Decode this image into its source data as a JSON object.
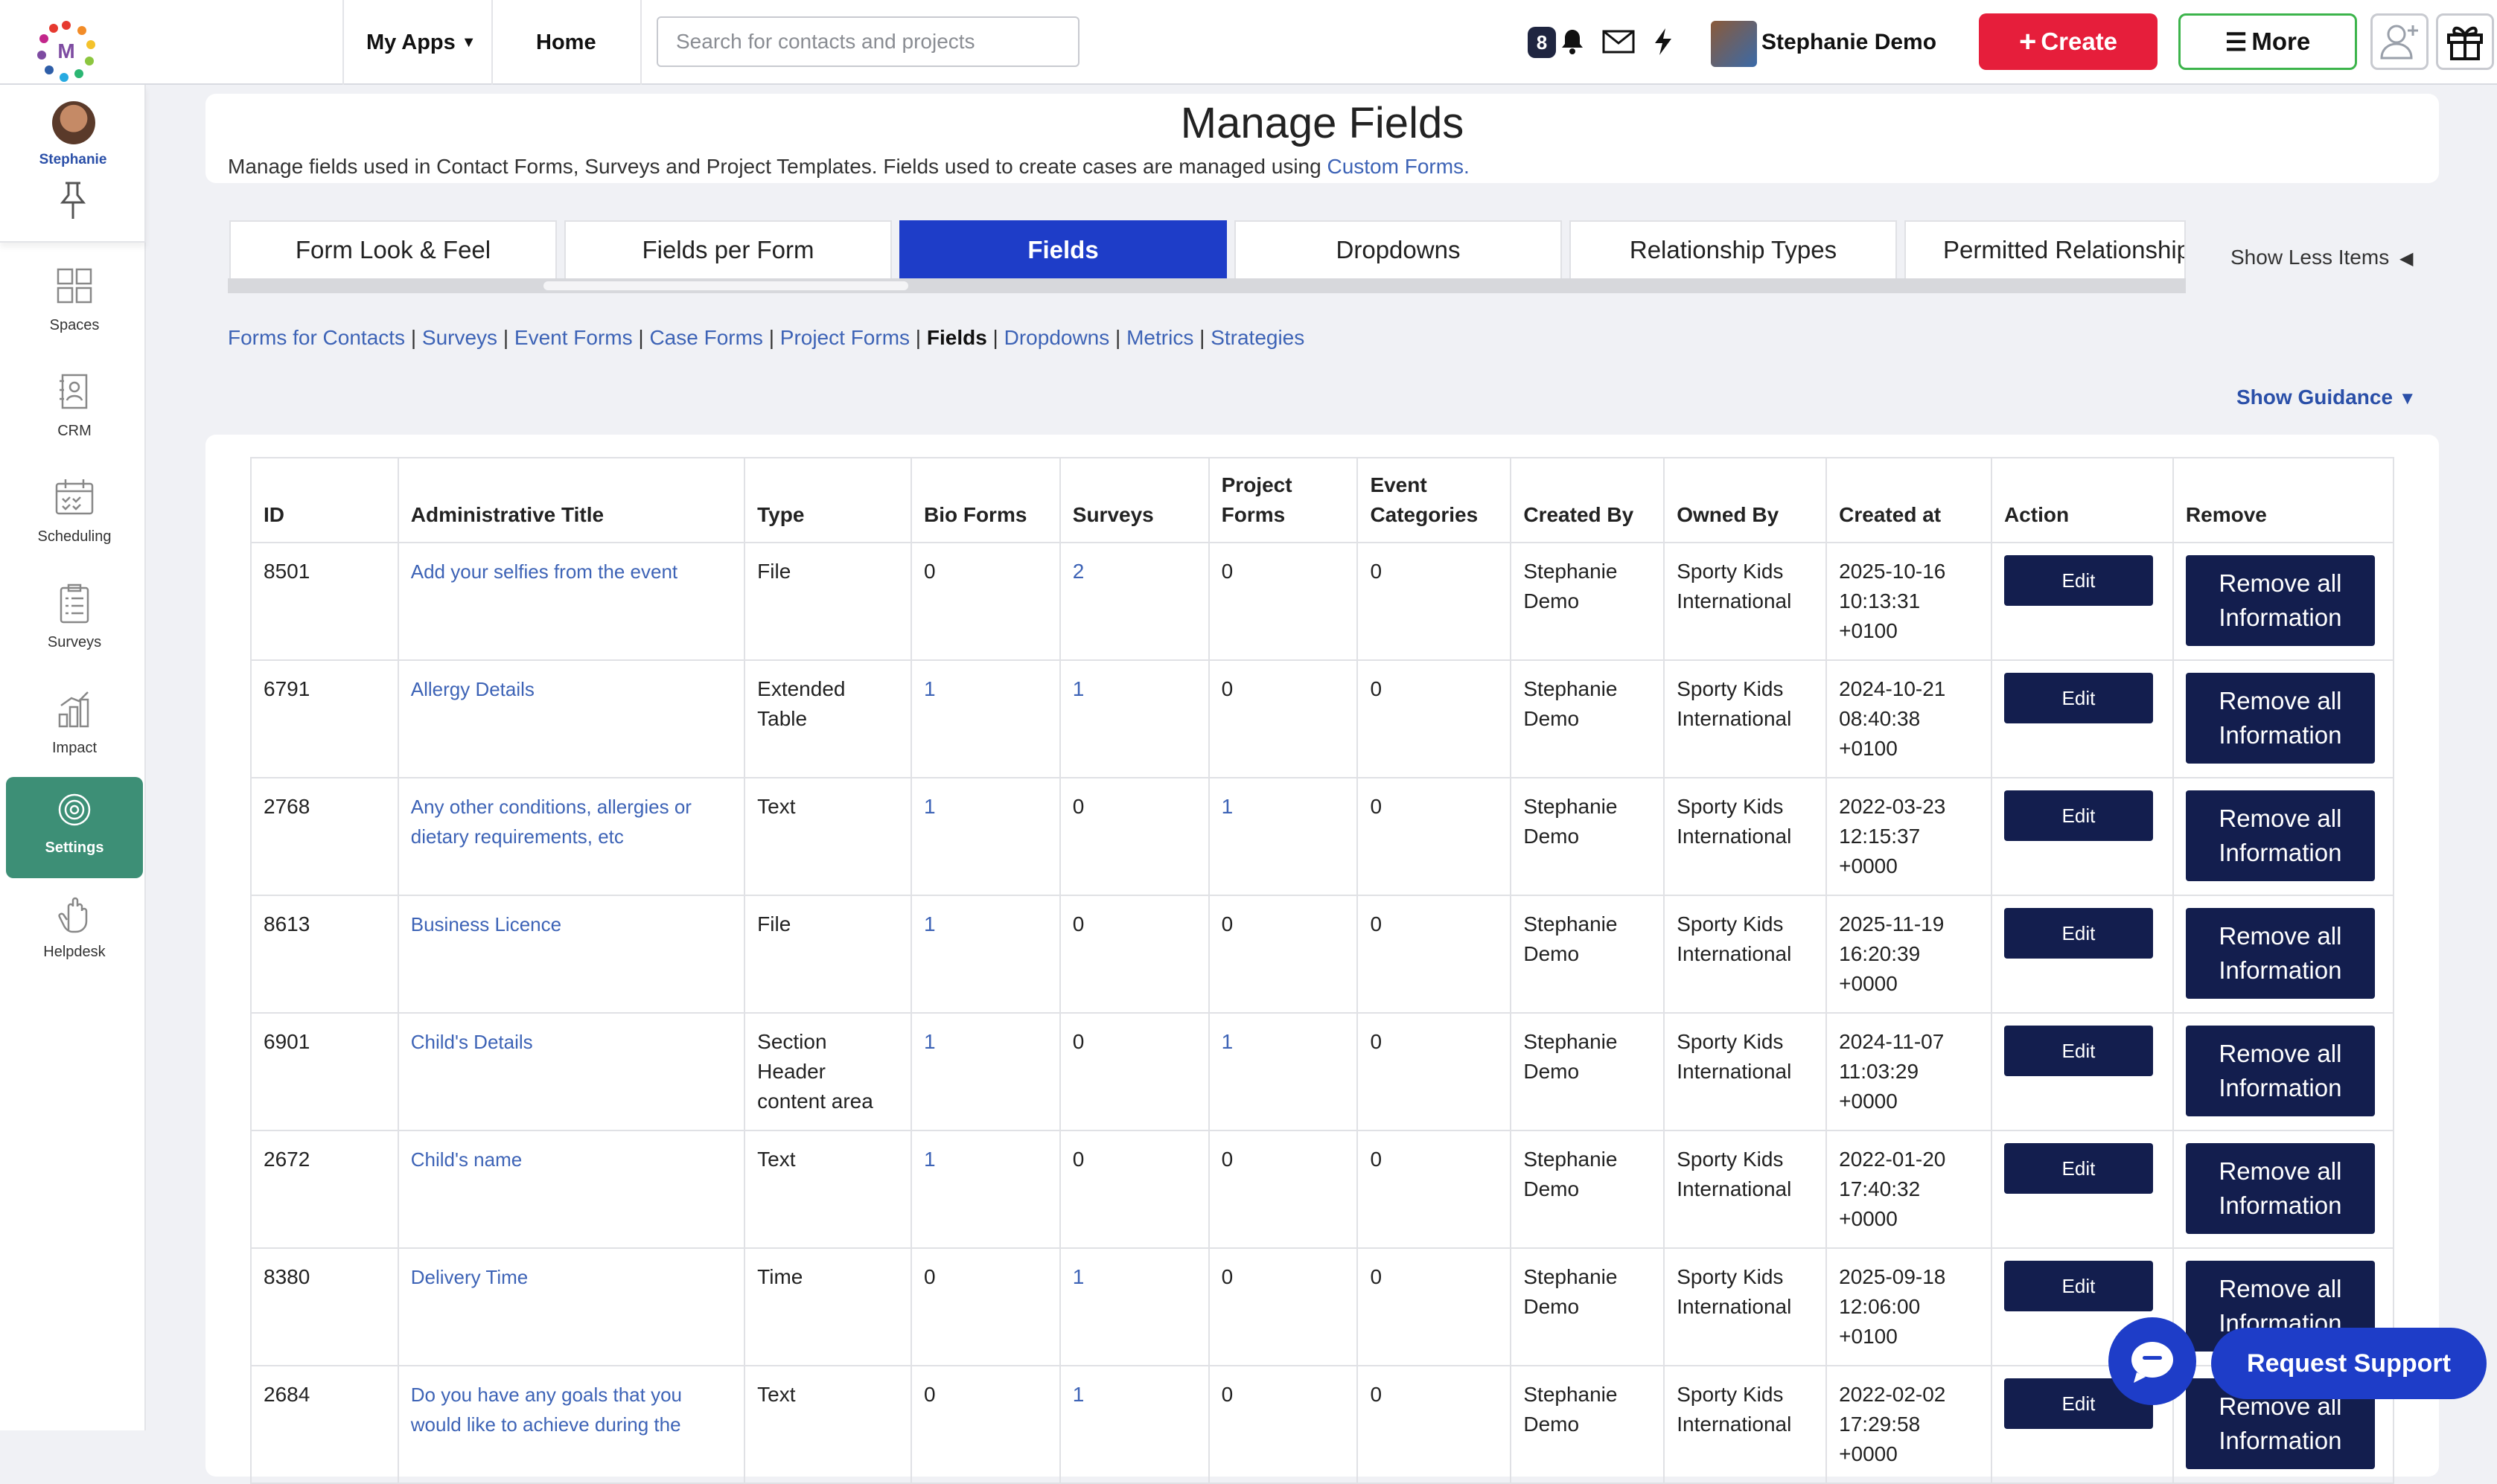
{
  "topbar": {
    "logo_letter": "M",
    "my_apps": "My Apps",
    "home": "Home",
    "search_placeholder": "Search for contacts and projects",
    "notification_count": "8",
    "user_name": "Stephanie Demo",
    "create_label": "Create",
    "more_label": "More"
  },
  "sidebar": {
    "username": "Stephanie",
    "items": [
      {
        "label": "Spaces",
        "icon": "spaces-icon"
      },
      {
        "label": "CRM",
        "icon": "crm-icon"
      },
      {
        "label": "Scheduling",
        "icon": "calendar-icon"
      },
      {
        "label": "Surveys",
        "icon": "clipboard-icon"
      },
      {
        "label": "Impact",
        "icon": "chart-icon"
      },
      {
        "label": "Settings",
        "icon": "gear-icon",
        "active": true
      },
      {
        "label": "Helpdesk",
        "icon": "hand-icon"
      }
    ]
  },
  "header": {
    "title": "Manage Fields",
    "description": "Manage fields used in Contact Forms, Surveys and Project Templates. Fields used to create cases are managed using",
    "description_link": "Custom Forms."
  },
  "tabs": [
    {
      "label": "Form Look & Feel"
    },
    {
      "label": "Fields per Form"
    },
    {
      "label": "Fields",
      "active": true
    },
    {
      "label": "Dropdowns"
    },
    {
      "label": "Relationship Types"
    },
    {
      "label": "Permitted Relationships"
    }
  ],
  "show_less": "Show Less Items",
  "sublinks": {
    "forms_for_contacts": "Forms for Contacts",
    "surveys": "Surveys",
    "event_forms": "Event Forms",
    "case_forms": "Case Forms",
    "project_forms": "Project Forms",
    "fields": "Fields",
    "dropdowns": "Dropdowns",
    "metrics": "Metrics",
    "strategies": "Strategies"
  },
  "show_guidance": "Show Guidance",
  "table": {
    "headers": [
      "ID",
      "Administrative Title",
      "Type",
      "Bio Forms",
      "Surveys",
      "Project Forms",
      "Event Categories",
      "Created By",
      "Owned By",
      "Created at",
      "Action",
      "Remove"
    ],
    "edit_label": "Edit",
    "remove_label": "Remove all Information",
    "rows": [
      {
        "id": "8501",
        "title": "Add your selfies from the event",
        "type": "File",
        "bio": "0",
        "surveys": "2",
        "project": "0",
        "event": "0",
        "created_by": "Stephanie Demo",
        "owned_by": "Sporty Kids International",
        "created_at": "2025-10-16 10:13:31 +0100"
      },
      {
        "id": "6791",
        "title": "Allergy Details",
        "type": "Extended Table",
        "bio": "1",
        "surveys": "1",
        "project": "0",
        "event": "0",
        "created_by": "Stephanie Demo",
        "owned_by": "Sporty Kids International",
        "created_at": "2024-10-21 08:40:38 +0100"
      },
      {
        "id": "2768",
        "title": "Any other conditions, allergies or dietary requirements, etc",
        "type": "Text",
        "bio": "1",
        "surveys": "0",
        "project": "1",
        "event": "0",
        "created_by": "Stephanie Demo",
        "owned_by": "Sporty Kids International",
        "created_at": "2022-03-23 12:15:37 +0000"
      },
      {
        "id": "8613",
        "title": "Business Licence",
        "type": "File",
        "bio": "1",
        "surveys": "0",
        "project": "0",
        "event": "0",
        "created_by": "Stephanie Demo",
        "owned_by": "Sporty Kids International",
        "created_at": "2025-11-19 16:20:39 +0000"
      },
      {
        "id": "6901",
        "title": "Child's Details",
        "type": "Section Header content area",
        "bio": "1",
        "surveys": "0",
        "project": "1",
        "event": "0",
        "created_by": "Stephanie Demo",
        "owned_by": "Sporty Kids International",
        "created_at": "2024-11-07 11:03:29 +0000"
      },
      {
        "id": "2672",
        "title": "Child's name",
        "type": "Text",
        "bio": "1",
        "surveys": "0",
        "project": "0",
        "event": "0",
        "created_by": "Stephanie Demo",
        "owned_by": "Sporty Kids International",
        "created_at": "2022-01-20 17:40:32 +0000"
      },
      {
        "id": "8380",
        "title": "Delivery Time",
        "type": "Time",
        "bio": "0",
        "surveys": "1",
        "project": "0",
        "event": "0",
        "created_by": "Stephanie Demo",
        "owned_by": "Sporty Kids International",
        "created_at": "2025-09-18 12:06:00 +0100"
      },
      {
        "id": "2684",
        "title": "Do you have any goals that you would like to achieve during the",
        "type": "Text",
        "bio": "0",
        "surveys": "1",
        "project": "0",
        "event": "0",
        "created_by": "Stephanie Demo",
        "owned_by": "Sporty Kids International",
        "created_at": "2022-02-02 17:29:58 +0000"
      }
    ]
  },
  "support": {
    "label": "Request Support"
  },
  "colors": {
    "create": "#e61e3b",
    "more_border": "#3cb44b",
    "tab_active": "#1e3dc8",
    "button_dark": "#131e4e",
    "settings_active": "#3d8f76",
    "link": "#3d63b6"
  }
}
